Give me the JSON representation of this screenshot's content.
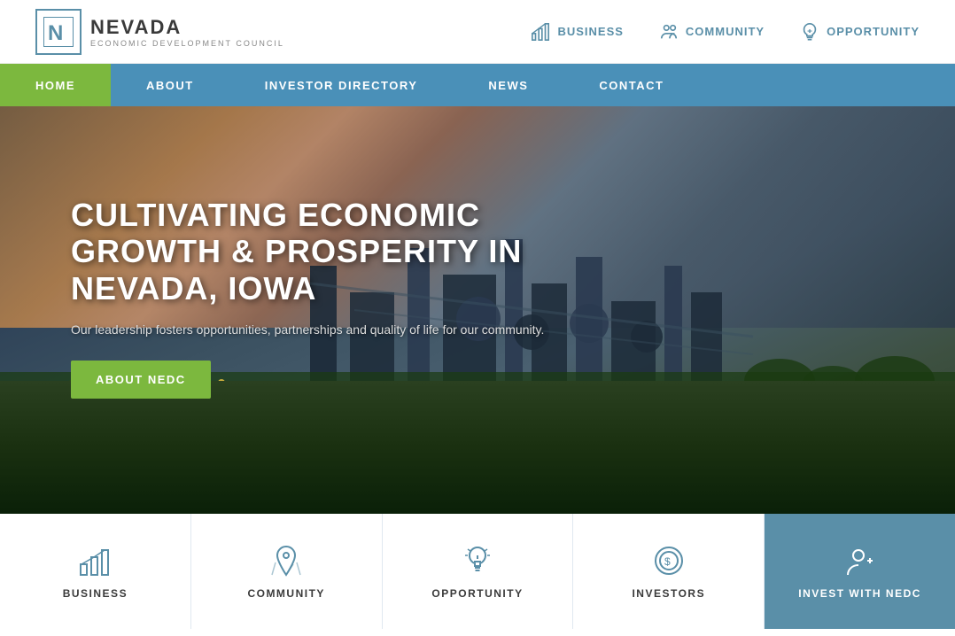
{
  "logo": {
    "letter": "N",
    "title": "NEVADA",
    "subtitle": "ECONOMIC DEVELOPMENT COUNCIL"
  },
  "top_nav": {
    "items": [
      {
        "id": "business",
        "label": "BUSINESS",
        "icon": "chart-icon"
      },
      {
        "id": "community",
        "label": "COMMUNITY",
        "icon": "community-icon"
      },
      {
        "id": "opportunity",
        "label": "OPPORTUNITY",
        "icon": "lightbulb-icon"
      }
    ]
  },
  "main_nav": {
    "items": [
      {
        "id": "home",
        "label": "HOME",
        "active": true
      },
      {
        "id": "about",
        "label": "ABOUT",
        "active": false
      },
      {
        "id": "investor-directory",
        "label": "INVESTOR DIRECTORY",
        "active": false
      },
      {
        "id": "news",
        "label": "NEWS",
        "active": false
      },
      {
        "id": "contact",
        "label": "CONTACT",
        "active": false
      }
    ]
  },
  "hero": {
    "title": "CULTIVATING ECONOMIC GROWTH & PROSPERITY IN NEVADA, IOWA",
    "subtitle": "Our leadership fosters opportunities, partnerships and quality of life for our community.",
    "button_label": "ABOUT NEDC"
  },
  "cards": {
    "items": [
      {
        "id": "business",
        "label": "BUSINESS",
        "icon": "card-chart-icon"
      },
      {
        "id": "community",
        "label": "COMMUNITY",
        "icon": "card-map-icon"
      },
      {
        "id": "opportunity",
        "label": "OPPORTUNITY",
        "icon": "card-bulb-icon"
      },
      {
        "id": "investors",
        "label": "INVESTORS",
        "icon": "card-dollar-icon"
      },
      {
        "id": "invest-with-nedc",
        "label": "INVEST WITH NEDC",
        "icon": "card-person-icon",
        "highlight": true
      }
    ]
  }
}
